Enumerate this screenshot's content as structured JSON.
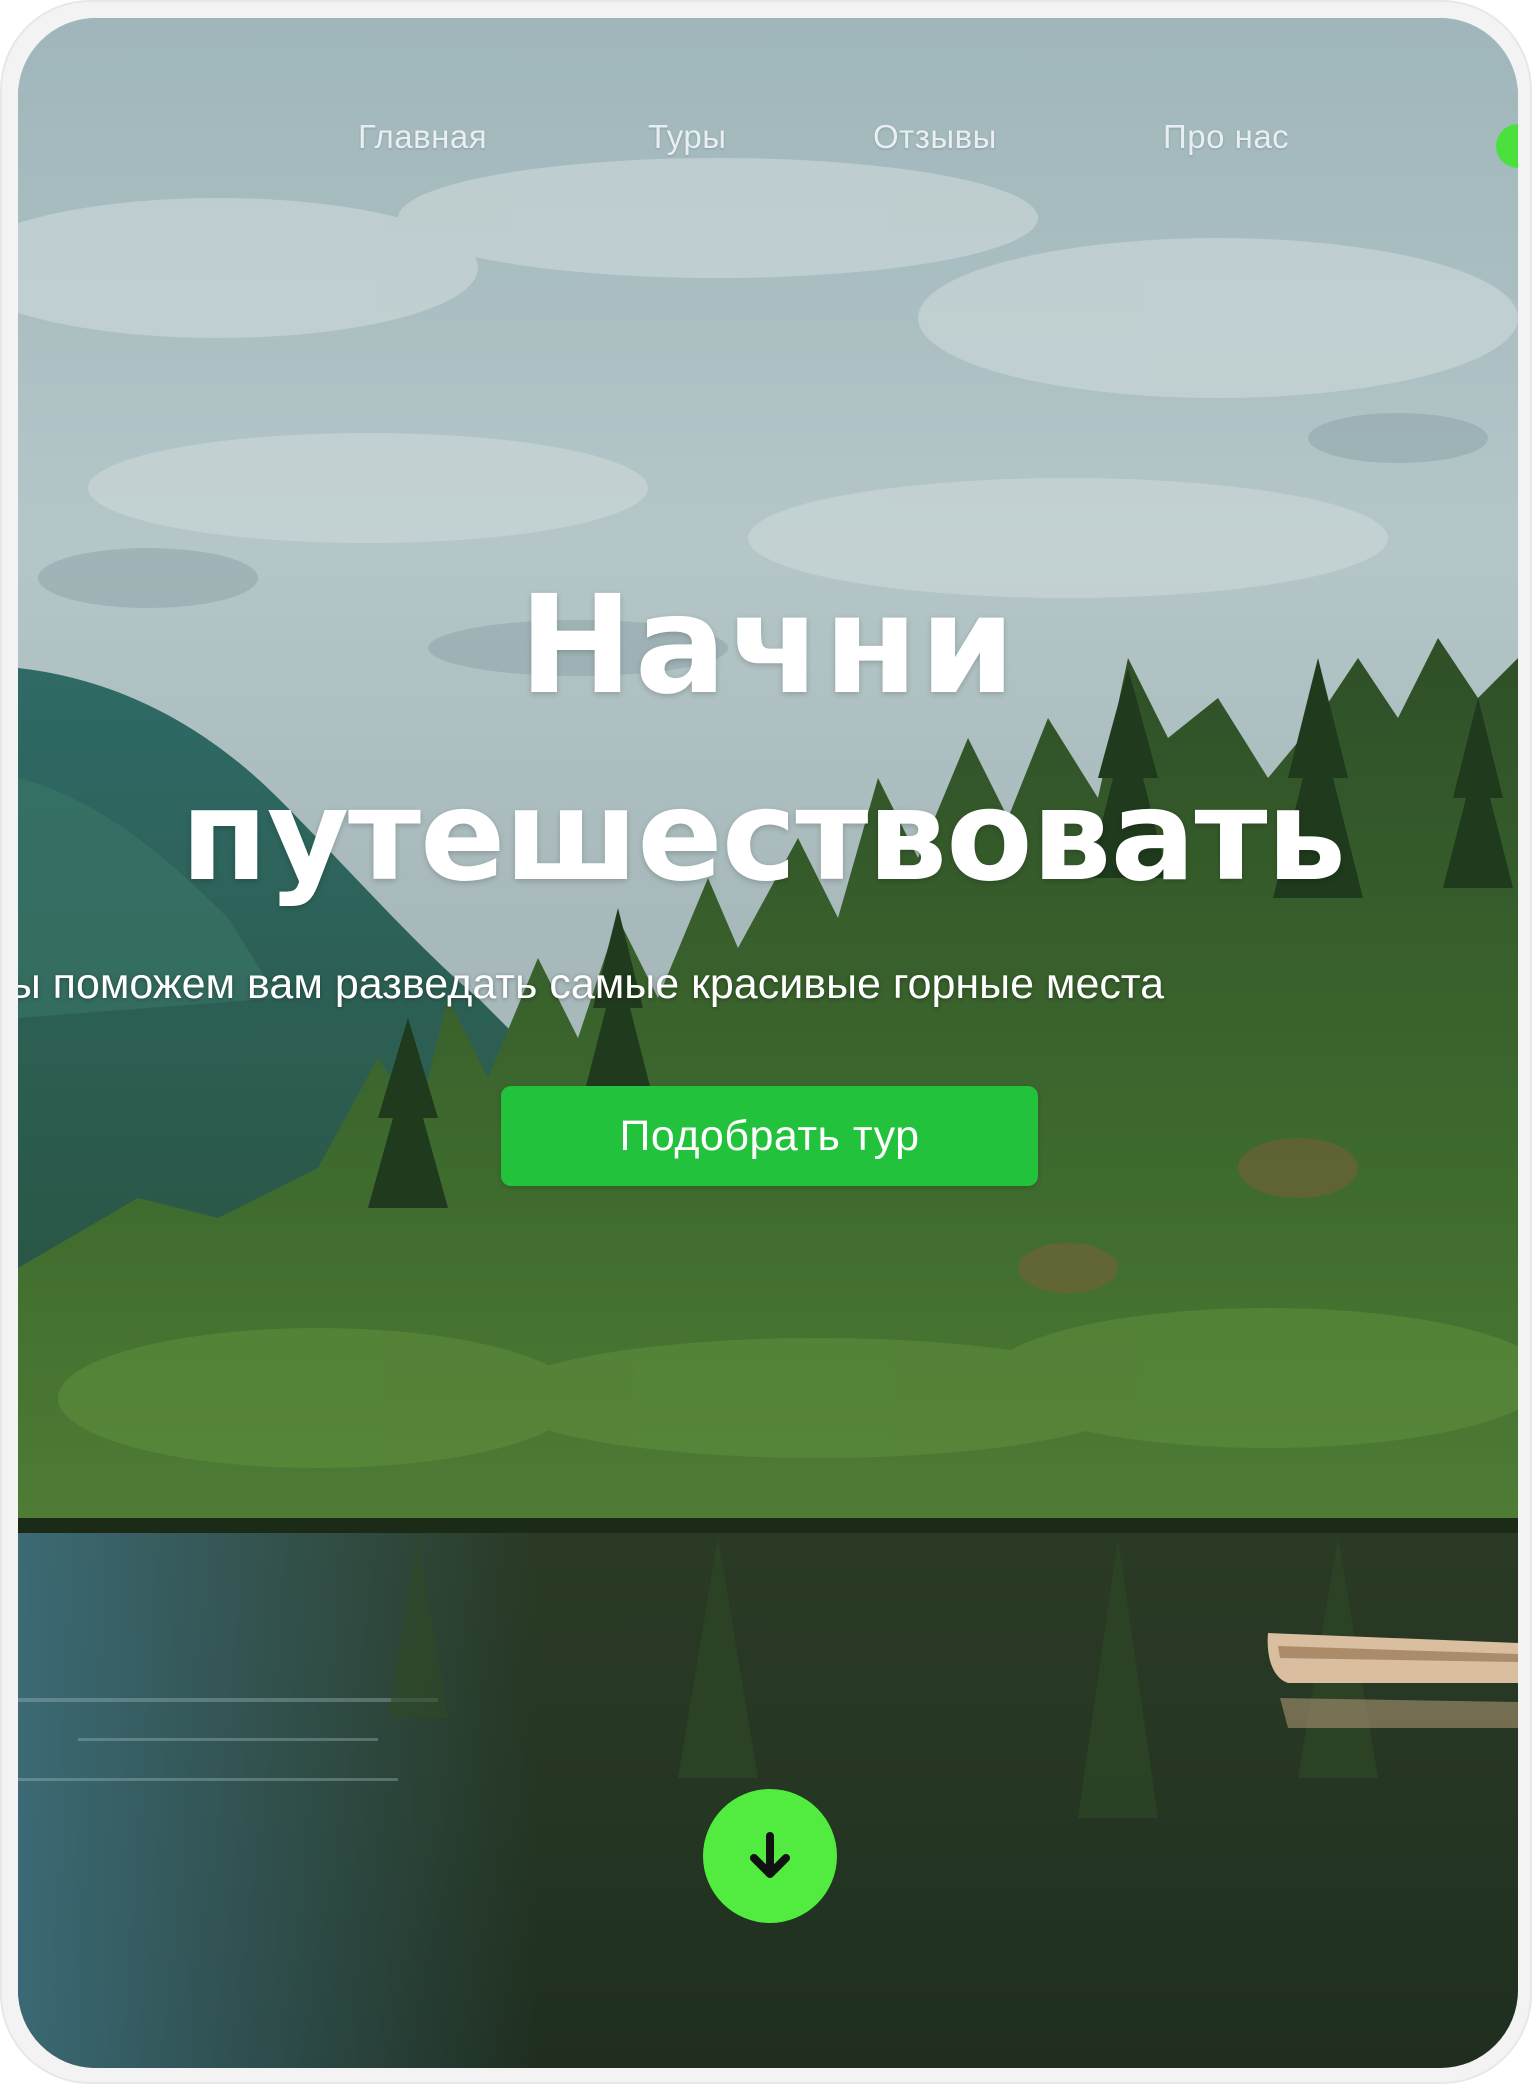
{
  "nav": {
    "items": [
      {
        "label": "Главная"
      },
      {
        "label": "Туры"
      },
      {
        "label": "Отзывы"
      },
      {
        "label": "Про нас"
      }
    ]
  },
  "hero": {
    "title_line1": "Начни",
    "title_line2": "путешествовать",
    "subtitle": "Мы поможем вам разведать самые красивые горные места",
    "cta_label": "Подобрать тур"
  },
  "scroll_icon": "arrow-down-icon",
  "colors": {
    "accent": "#22c23c",
    "scroll_button": "#52ec40",
    "nav_text": "#e9eef0"
  }
}
